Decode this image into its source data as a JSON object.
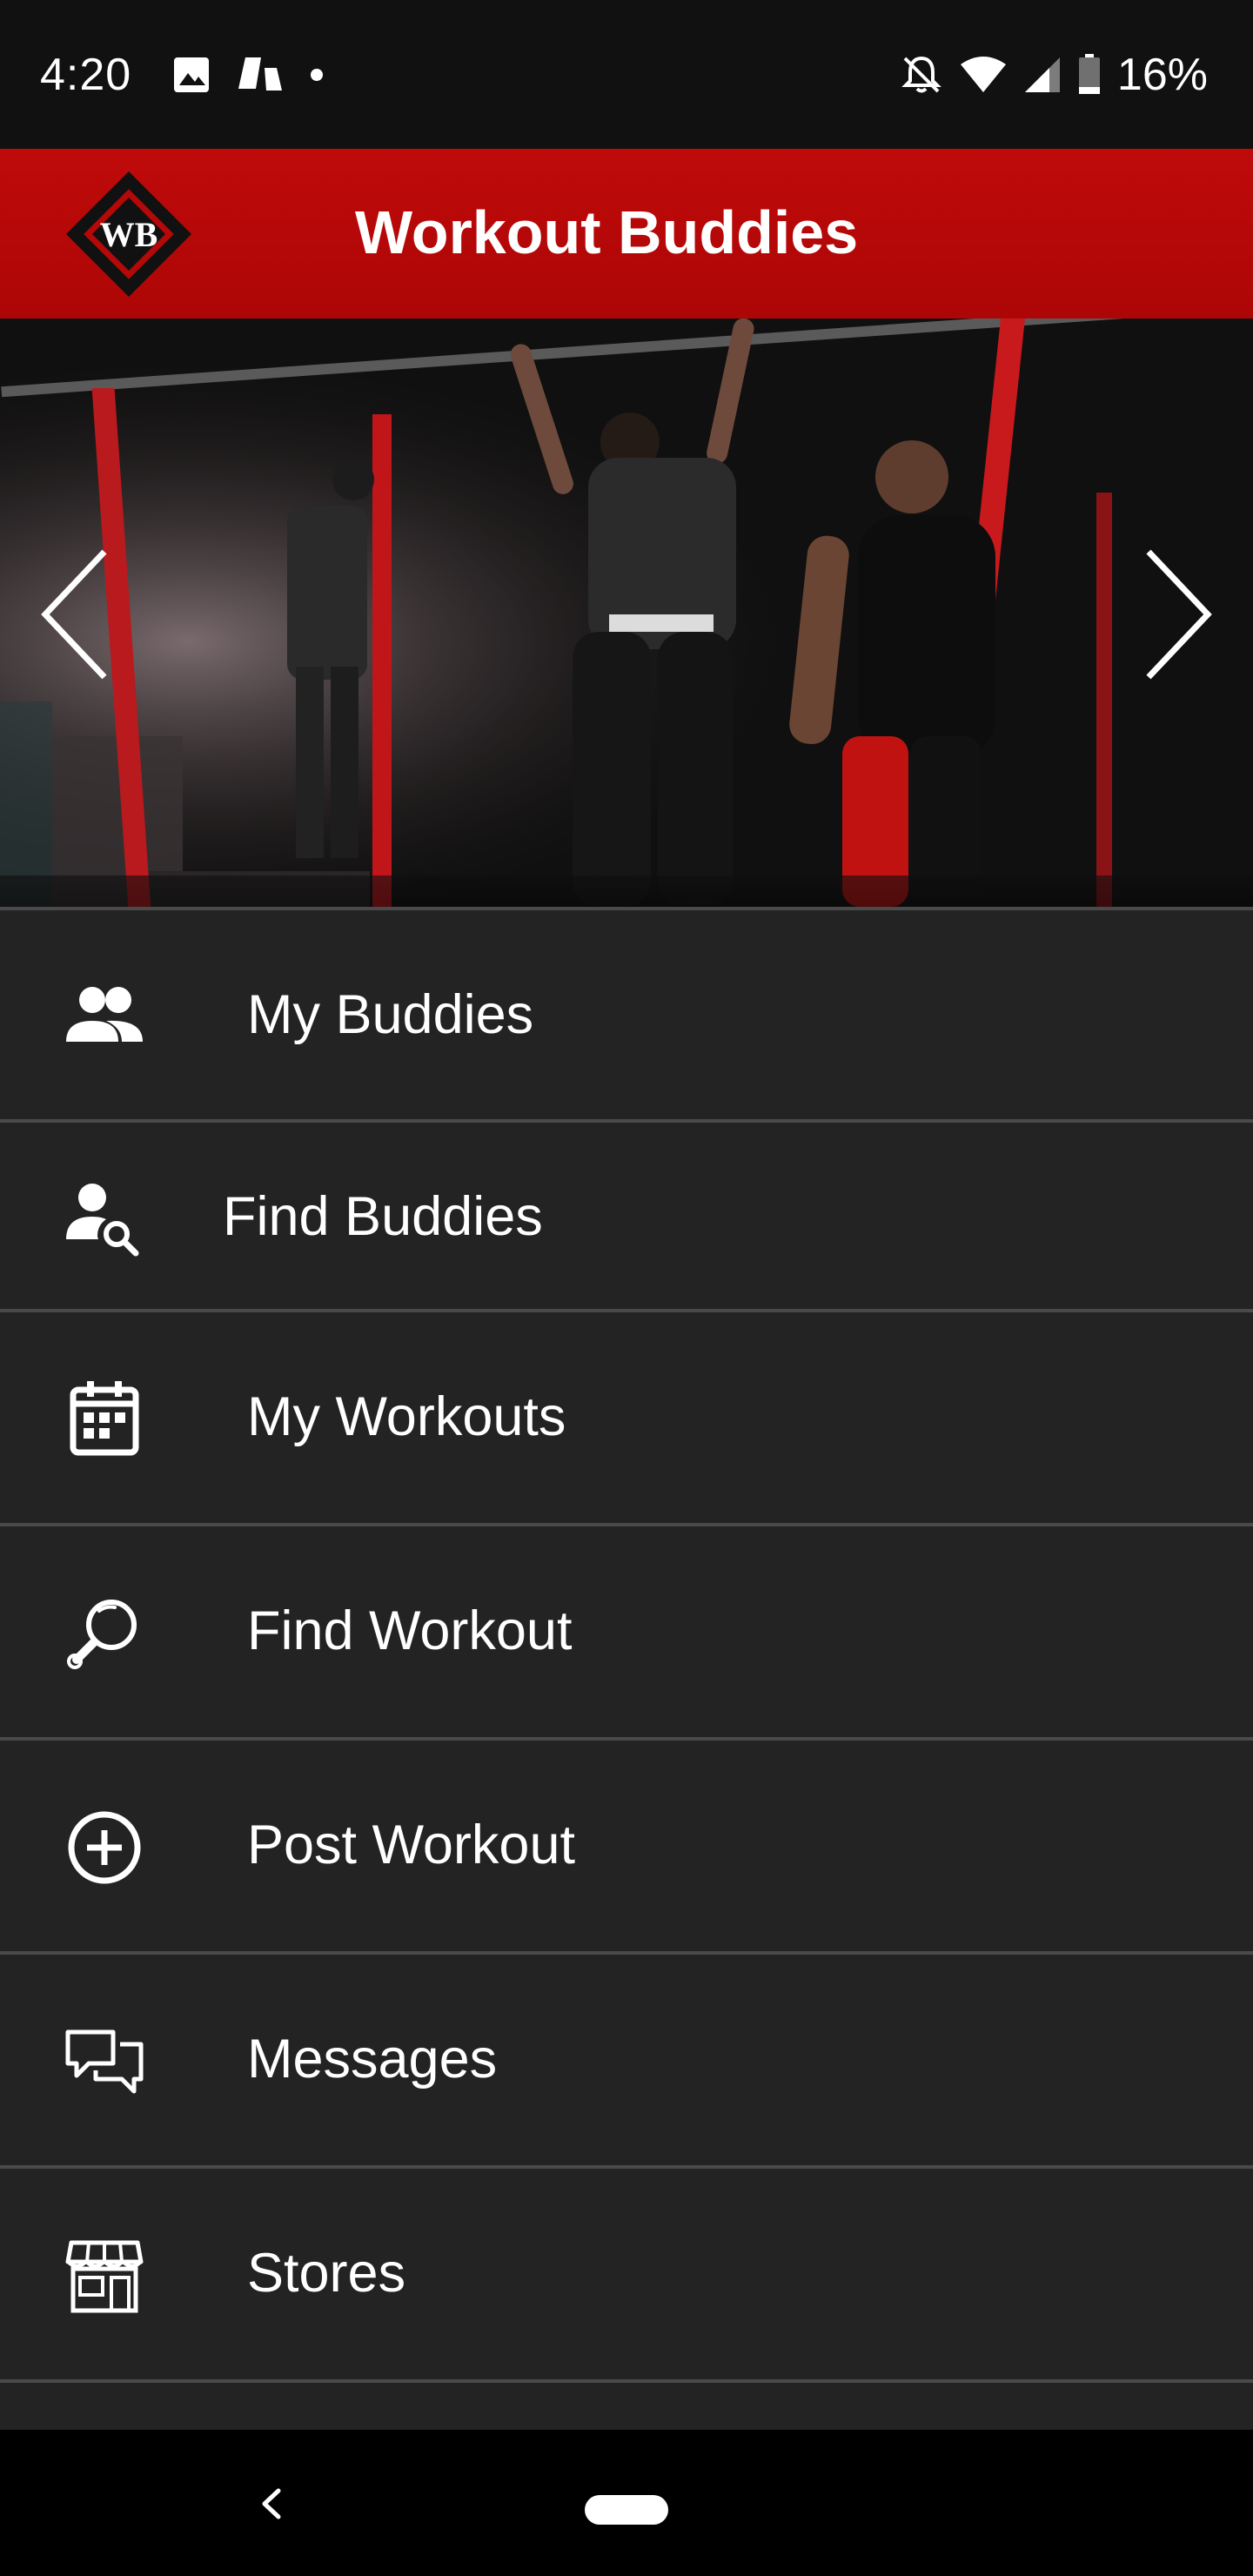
{
  "status_bar": {
    "time": "4:20",
    "battery": "16%",
    "icons": [
      "image-icon",
      "notification-app-icon",
      "dot-icon",
      "bell-off-icon",
      "wifi-icon",
      "signal-icon",
      "battery-icon"
    ]
  },
  "header": {
    "title": "Workout Buddies",
    "logo_text": "WB",
    "colors": {
      "header_red": "#b50808"
    }
  },
  "carousel": {
    "prev_icon": "chevron-left-icon",
    "next_icon": "chevron-right-icon"
  },
  "menu": {
    "items": [
      {
        "label": "My Buddies",
        "icon": "people-icon"
      },
      {
        "label": "Find Buddies",
        "icon": "person-search-icon"
      },
      {
        "label": "My Workouts",
        "icon": "calendar-icon"
      },
      {
        "label": "Find Workout",
        "icon": "magnifier-icon"
      },
      {
        "label": "Post Workout",
        "icon": "add-circle-icon"
      },
      {
        "label": "Messages",
        "icon": "chat-icon"
      },
      {
        "label": "Stores",
        "icon": "store-icon"
      }
    ]
  },
  "nav": {
    "back_icon": "back-icon",
    "home_icon": "home-pill-icon"
  }
}
